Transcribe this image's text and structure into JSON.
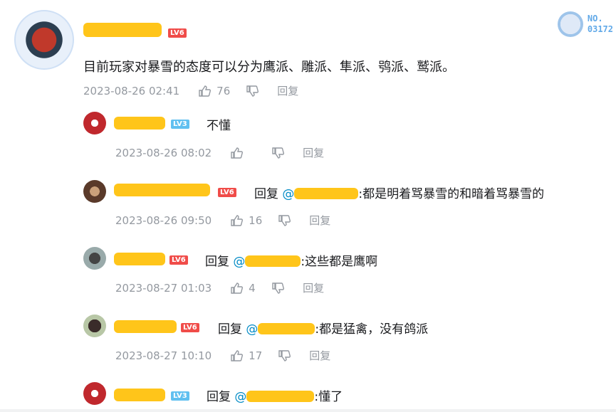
{
  "main_comment": {
    "level": "LV6",
    "text": "目前玩家对暴雪的态度可以分为鹰派、雕派、隼派、鸮派、鹫派。",
    "time": "2023-08-26 02:41",
    "likes": "76",
    "reply_label": "回复"
  },
  "badge": {
    "line1": "NO.",
    "line2": "03172"
  },
  "replies": [
    {
      "level": "LV3",
      "level_color": "blue",
      "prefix": "",
      "mention": "",
      "text": "不懂",
      "time": "2023-08-26 08:02",
      "likes": "",
      "reply_label": "回复"
    },
    {
      "level": "LV6",
      "level_color": "red",
      "prefix": "回复 ",
      "mention": "@",
      "text": ":都是明着骂暴雪的和暗着骂暴雪的",
      "time": "2023-08-26 09:50",
      "likes": "16",
      "reply_label": "回复"
    },
    {
      "level": "LV6",
      "level_color": "red",
      "prefix": "回复 ",
      "mention": "@",
      "text": ":这些都是鹰啊",
      "time": "2023-08-27 01:03",
      "likes": "4",
      "reply_label": "回复"
    },
    {
      "level": "LV6",
      "level_color": "red",
      "prefix": "回复 ",
      "mention": "@",
      "text": ":都是猛禽，没有鸽派",
      "time": "2023-08-27 10:10",
      "likes": "17",
      "reply_label": "回复"
    },
    {
      "level": "LV3",
      "level_color": "blue",
      "prefix": "回复 ",
      "mention": "@",
      "text": ":懂了",
      "time": "",
      "likes": "",
      "reply_label": ""
    }
  ]
}
